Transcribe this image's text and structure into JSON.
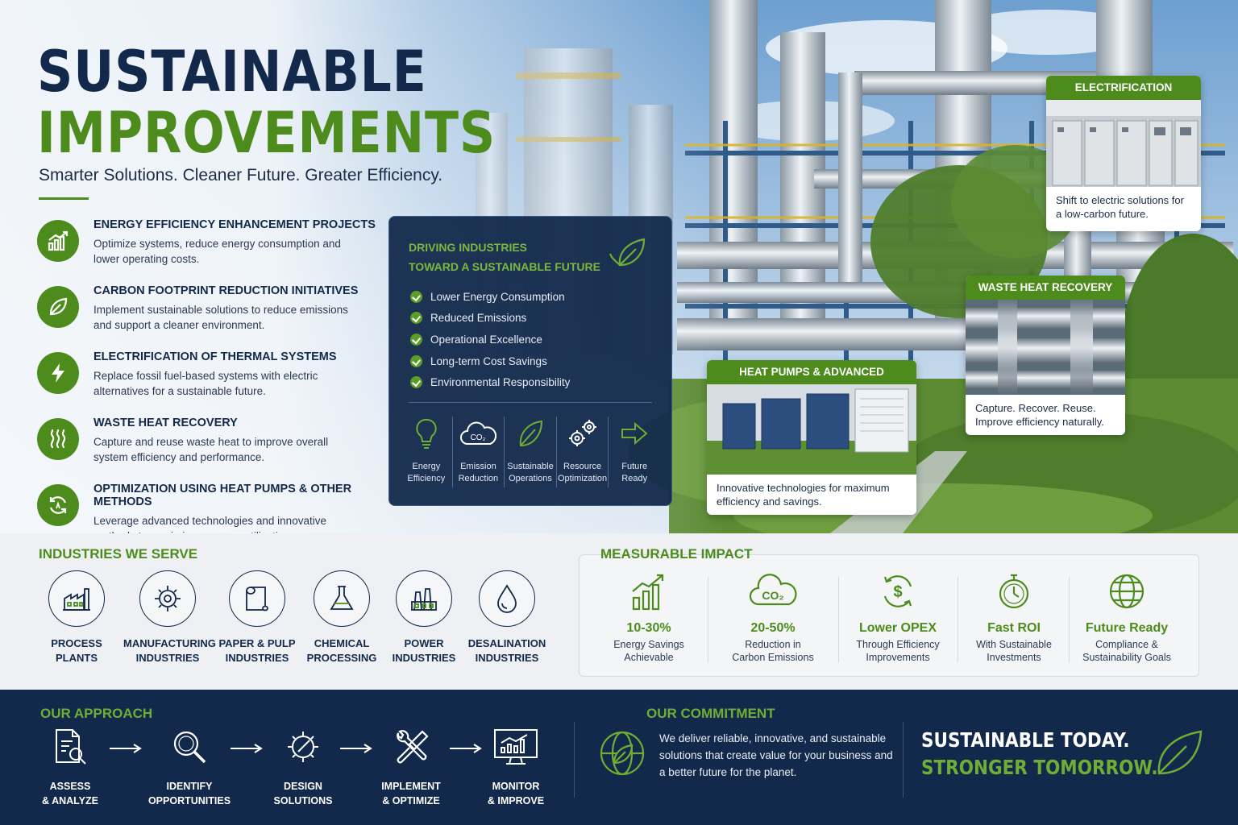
{
  "hero": {
    "title_line1": "SUSTAINABLE",
    "title_line2": "IMPROVEMENTS",
    "subtitle": "Smarter Solutions. Cleaner Future. Greater Efficiency."
  },
  "features": [
    {
      "icon": "bar-chart-growth-icon",
      "title": "Energy Efficiency Enhancement Projects",
      "desc": "Optimize systems, reduce energy consumption and lower operating costs."
    },
    {
      "icon": "leaf-icon",
      "title": "Carbon Footprint Reduction Initiatives",
      "desc": "Implement sustainable solutions to reduce emissions and support a cleaner environment."
    },
    {
      "icon": "lightning-bolt-icon",
      "title": "Electrification of Thermal Systems",
      "desc": "Replace fossil fuel-based systems with electric alternatives for a sustainable future."
    },
    {
      "icon": "heat-waves-icon",
      "title": "Waste Heat Recovery",
      "desc": "Capture and reuse waste heat to improve overall system efficiency and performance."
    },
    {
      "icon": "cycle-arrows-icon",
      "title": "Optimization Using Heat Pumps & Other Methods",
      "desc": "Leverage advanced technologies and innovative methods to maximize resource utilization."
    }
  ],
  "panel": {
    "heading_line1": "DRIVING INDUSTRIES",
    "heading_line2": "TOWARD A SUSTAINABLE FUTURE",
    "benefits": [
      "Lower Energy Consumption",
      "Reduced Emissions",
      "Operational Excellence",
      "Long-term Cost Savings",
      "Environmental Responsibility"
    ],
    "icons": [
      {
        "icon": "lightbulb-icon",
        "line1": "Energy",
        "line2": "Efficiency"
      },
      {
        "icon": "co2-cloud-icon",
        "line1": "Emission",
        "line2": "Reduction"
      },
      {
        "icon": "leaf-icon",
        "line1": "Sustainable",
        "line2": "Operations"
      },
      {
        "icon": "gears-icon",
        "line1": "Resource",
        "line2": "Optimization"
      },
      {
        "icon": "arrow-right-icon",
        "line1": "Future",
        "line2": "Ready"
      }
    ]
  },
  "cards": {
    "electrification": {
      "title": "ELECTRIFICATION",
      "desc": "Shift to electric solutions for a low-carbon future."
    },
    "waste_heat": {
      "title": "WASTE HEAT RECOVERY",
      "desc": "Capture. Recover. Reuse. Improve efficiency naturally."
    },
    "heat_pumps": {
      "title": "HEAT PUMPS & ADVANCED SOLUTIONS",
      "desc": "Innovative technologies for maximum efficiency and savings."
    }
  },
  "industries": {
    "heading": "INDUSTRIES WE SERVE",
    "items": [
      {
        "icon": "factory-icon",
        "line1": "PROCESS",
        "line2": "PLANTS"
      },
      {
        "icon": "gear-icon",
        "line1": "MANUFACTURING",
        "line2": "INDUSTRIES"
      },
      {
        "icon": "paper-roll-icon",
        "line1": "PAPER & PULP",
        "line2": "INDUSTRIES"
      },
      {
        "icon": "flask-icon",
        "line1": "CHEMICAL",
        "line2": "PROCESSING"
      },
      {
        "icon": "power-plant-icon",
        "line1": "POWER",
        "line2": "INDUSTRIES"
      },
      {
        "icon": "water-drop-icon",
        "line1": "DESALINATION",
        "line2": "INDUSTRIES"
      }
    ]
  },
  "impact": {
    "heading": "MEASURABLE IMPACT",
    "items": [
      {
        "icon": "bar-chart-growth-icon",
        "value": "10-30%",
        "line1": "Energy Savings",
        "line2": "Achievable"
      },
      {
        "icon": "co2-cloud-icon",
        "value": "20-50%",
        "line1": "Reduction in",
        "line2": "Carbon Emissions"
      },
      {
        "icon": "dollar-cycle-icon",
        "value": "Lower OPEX",
        "line1": "Through Efficiency",
        "line2": "Improvements"
      },
      {
        "icon": "stopwatch-icon",
        "value": "Fast ROI",
        "line1": "With Sustainable",
        "line2": "Investments"
      },
      {
        "icon": "globe-icon",
        "value": "Future Ready",
        "line1": "Compliance &",
        "line2": "Sustainability Goals"
      }
    ]
  },
  "approach": {
    "heading": "OUR APPROACH",
    "steps": [
      {
        "icon": "document-search-icon",
        "line1": "ASSESS",
        "line2": "& ANALYZE"
      },
      {
        "icon": "magnifier-icon",
        "line1": "IDENTIFY",
        "line2": "OPPORTUNITIES"
      },
      {
        "icon": "gear-pencil-icon",
        "line1": "DESIGN",
        "line2": "SOLUTIONS"
      },
      {
        "icon": "tools-icon",
        "line1": "IMPLEMENT",
        "line2": "& OPTIMIZE"
      },
      {
        "icon": "monitor-chart-icon",
        "line1": "MONITOR",
        "line2": "& IMPROVE"
      }
    ]
  },
  "commitment": {
    "heading": "OUR COMMITMENT",
    "text": "We deliver reliable, innovative, and sustainable solutions that create value for your business and a better future for the planet."
  },
  "tagline": {
    "line1": "SUSTAINABLE TODAY.",
    "line2": "STRONGER TOMORROW."
  },
  "colors": {
    "navy": "#13294b",
    "green": "#4d8c1c",
    "light_green": "#6fae34",
    "background": "#eef0f3"
  }
}
